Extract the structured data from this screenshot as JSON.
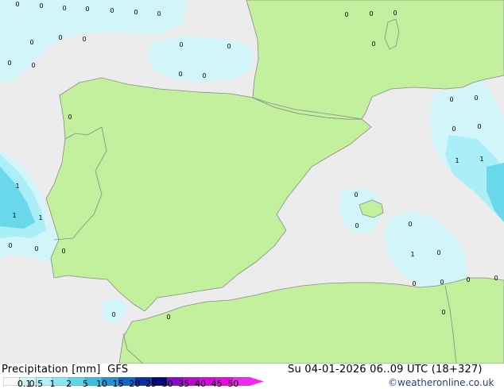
{
  "header": {
    "product_label": "Precipitation [mm]",
    "model_label": "GFS",
    "valid_time": "Su 04-01-2026 06..09 UTC (18+327)",
    "credit": "©weatheronline.co.uk"
  },
  "legend": {
    "ticks": [
      "0.1",
      "0.5",
      "1",
      "2",
      "5",
      "10",
      "15",
      "20",
      "25",
      "30",
      "35",
      "40",
      "45",
      "50"
    ],
    "colors": [
      "#fafafa",
      "#d6f6fb",
      "#b2eff7",
      "#8ae6f2",
      "#5dd5ea",
      "#3bbde0",
      "#2791d6",
      "#1464c4",
      "#0a32a6",
      "#08087e",
      "#8a0ac8",
      "#b60ace",
      "#d40ad8",
      "#e40ae0",
      "#ee2aee"
    ]
  },
  "map": {
    "colors": {
      "sea": "#ececec",
      "land": "#c2f09c",
      "precip_light": "#d2f5fa",
      "precip_medium": "#aaeef7",
      "precip_heavy": "#68d8ea",
      "border": "#8a8a8a"
    },
    "value_labels": [
      "0",
      "0",
      "0",
      "0",
      "0",
      "0",
      "0",
      "0",
      "0",
      "0",
      "0",
      "0",
      "0",
      "0",
      "0",
      "0",
      "0",
      "0",
      "0",
      "0",
      "0",
      "1",
      "1",
      "1",
      "1",
      "1",
      "1",
      "0",
      "0",
      "0",
      "0",
      "0",
      "0",
      "0",
      "0",
      "0",
      "0",
      "0",
      "0",
      "0",
      "0",
      "0",
      "0",
      "0",
      "0"
    ]
  }
}
